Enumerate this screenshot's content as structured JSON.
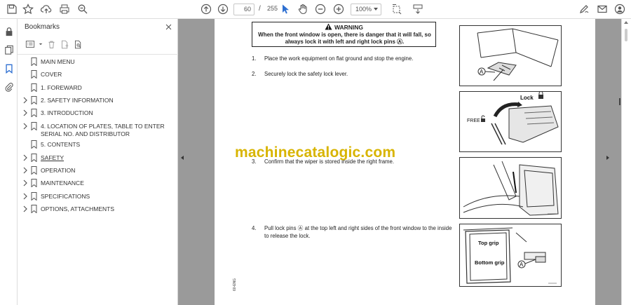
{
  "toolbar": {
    "page_current": "60",
    "page_separator": "/",
    "page_total": "255",
    "zoom": "100%"
  },
  "bookmarks_panel": {
    "title": "Bookmarks",
    "items": [
      {
        "label": "MAIN MENU",
        "expandable": false
      },
      {
        "label": "COVER",
        "expandable": false
      },
      {
        "label": "1. FOREWARD",
        "expandable": false
      },
      {
        "label": "2. SAFETY INFORMATION",
        "expandable": true
      },
      {
        "label": "3. INTRODUCTION",
        "expandable": true
      },
      {
        "label": "4. LOCATION OF PLATES, TABLE TO ENTER SERIAL NO. AND DISTRIBUTOR",
        "expandable": true
      },
      {
        "label": "5. CONTENTS",
        "expandable": false
      },
      {
        "label": "SAFETY",
        "expandable": true
      },
      {
        "label": "OPERATION",
        "expandable": true
      },
      {
        "label": "MAINTENANCE",
        "expandable": true
      },
      {
        "label": "SPECIFICATIONS",
        "expandable": true
      },
      {
        "label": "OPTIONS, ATTACHMENTS",
        "expandable": true
      }
    ]
  },
  "document": {
    "warning_title": "WARNING",
    "warning_text": "When the front window is open, there is danger that it will fall, so always lock it with left and right lock pins Ⓐ.",
    "steps": [
      {
        "num": "1.",
        "text": "Place the work equipment on flat ground and stop the engine."
      },
      {
        "num": "2.",
        "text": "Securely lock the safety lock lever."
      },
      {
        "num": "3.",
        "text": "Confirm that the wiper is stored inside the right frame."
      },
      {
        "num": "4.",
        "text": "Pull lock pins Ⓐ at the top left and right sides of the front window to the inside to release the lock."
      }
    ],
    "fig_labels": {
      "fig1_a": "A",
      "fig2_lock": "Lock",
      "fig2_free": "FREE",
      "fig4_top": "Top grip",
      "fig4_bottom": "Bottom grip",
      "fig4_a": "A"
    },
    "watermark": "machinecatalogic.com",
    "side_code": "60-ENG"
  }
}
